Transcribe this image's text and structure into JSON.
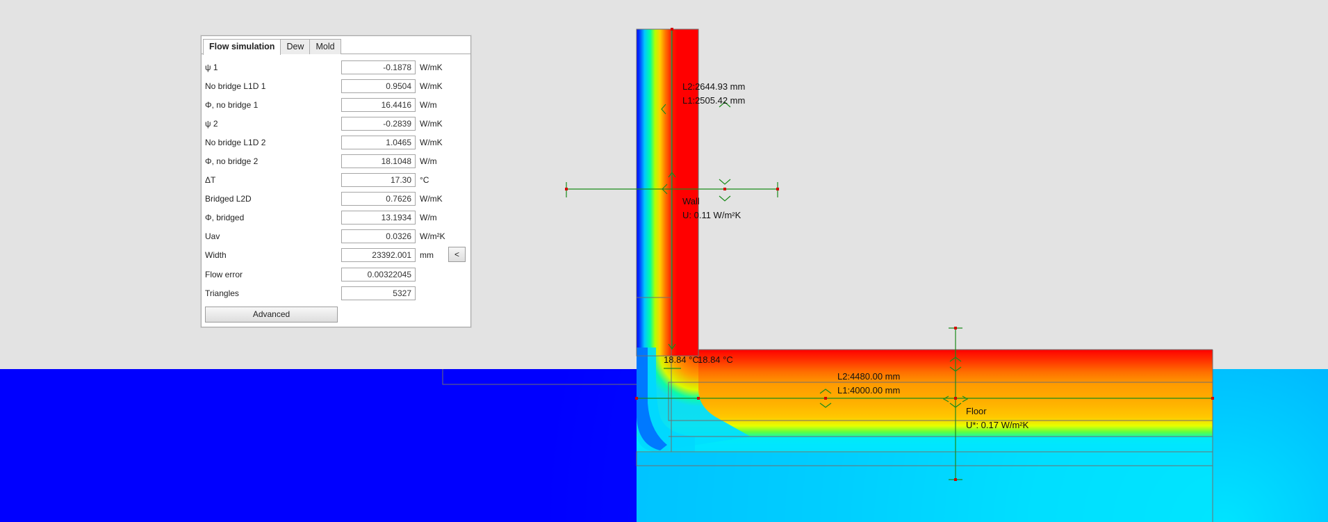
{
  "panel": {
    "tabs": [
      {
        "label": "Flow simulation",
        "active": true
      },
      {
        "label": "Dew",
        "active": false
      },
      {
        "label": "Mold",
        "active": false
      }
    ],
    "rows": [
      {
        "label": "ψ 1",
        "value": "-0.1878",
        "unit": "W/mK"
      },
      {
        "label": "No bridge L1D 1",
        "value": "0.9504",
        "unit": "W/mK"
      },
      {
        "label": "Φ, no bridge 1",
        "value": "16.4416",
        "unit": "W/m"
      },
      {
        "label": "ψ 2",
        "value": "-0.2839",
        "unit": "W/mK"
      },
      {
        "label": "No bridge L1D 2",
        "value": "1.0465",
        "unit": "W/mK"
      },
      {
        "label": "Φ, no bridge 2",
        "value": "18.1048",
        "unit": "W/m"
      },
      {
        "label": "ΔT",
        "value": "17.30",
        "unit": "°C"
      },
      {
        "label": "Bridged L2D",
        "value": "0.7626",
        "unit": "W/mK"
      },
      {
        "label": "Φ, bridged",
        "value": "13.1934",
        "unit": "W/m"
      },
      {
        "label": "Uav",
        "value": "0.0326",
        "unit": "W/m²K"
      },
      {
        "label": "Width",
        "value": "23392.001",
        "unit": "mm"
      },
      {
        "label": "Flow error",
        "value": "0.00322045",
        "unit": ""
      },
      {
        "label": "Triangles",
        "value": "5327",
        "unit": ""
      }
    ],
    "collapse_label": "<",
    "advanced_label": "Advanced"
  },
  "canvas": {
    "wall": {
      "l2": "L2:2644.93 mm",
      "l1": "L1:2505.42 mm",
      "name": "Wall",
      "u": "U: 0.11 W/m²K"
    },
    "floor": {
      "l2": "L2:4480.00 mm",
      "l1": "L1:4000.00 mm",
      "name": "Floor",
      "u": "U*: 0.17 W/m²K"
    },
    "corner_temp_1": "18.84 °C",
    "corner_temp_2": "18.84 °C",
    "colors": {
      "background": "#e3e3e3",
      "cold": "#0000ff",
      "warm": "#ff0000",
      "cyan": "#00e5ff",
      "dimension_line": "#1a8a1a",
      "marker": "#d40000"
    }
  }
}
